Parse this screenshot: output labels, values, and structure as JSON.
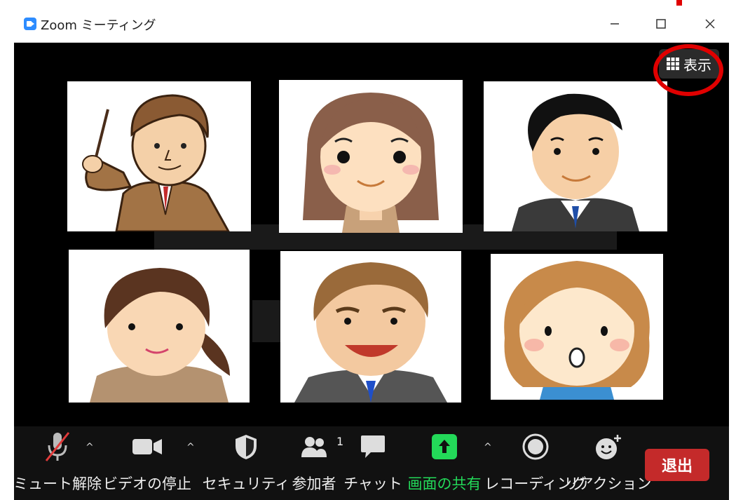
{
  "window": {
    "title": "Zoom ミーティング"
  },
  "view_button": {
    "label": "表示"
  },
  "toolbar": {
    "mute": "ミュート解除",
    "video": "ビデオの停止",
    "security": "セキュリティ",
    "participants": "参加者",
    "participant_count": "1",
    "chat": "チャット",
    "share": "画面の共有",
    "record": "レコーディング",
    "reactions": "リアクション",
    "leave": "退出"
  },
  "colors": {
    "share_green": "#23d959",
    "leave_red": "#c42a2a",
    "highlight_red": "#e00000",
    "zoom_blue": "#2d8cff"
  },
  "participants": [
    {
      "icon": "teacher-man-pointer-avatar"
    },
    {
      "icon": "woman-long-hair-avatar"
    },
    {
      "icon": "man-black-hair-suit-avatar"
    },
    {
      "icon": "woman-ponytail-avatar"
    },
    {
      "icon": "man-smiling-suit-avatar"
    },
    {
      "icon": "girl-surprised-avatar"
    }
  ]
}
